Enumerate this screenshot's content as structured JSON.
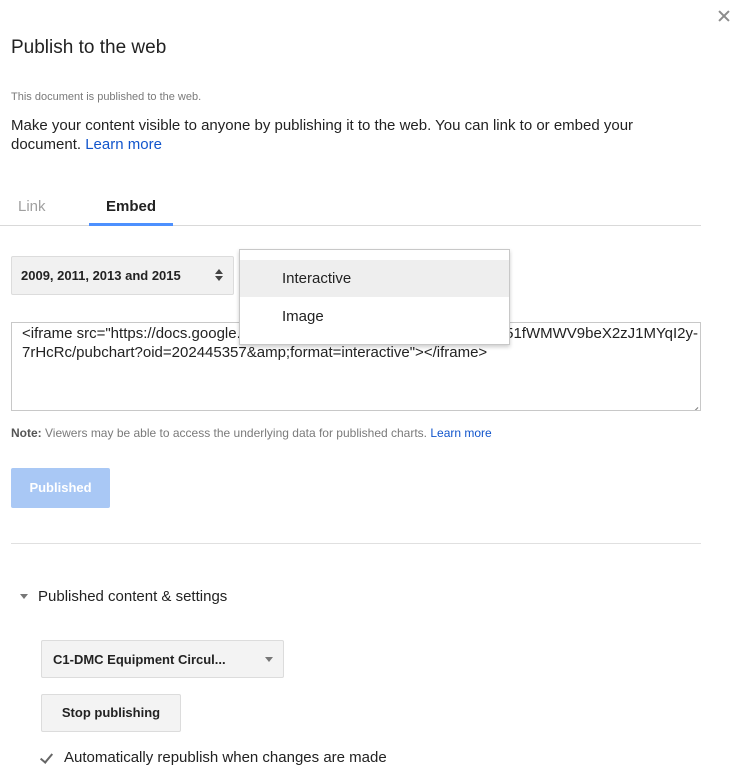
{
  "dialog": {
    "title": "Publish to the web",
    "status": "This document is published to the web.",
    "description": "Make your content visible to anyone by publishing it to the web. You can link to or embed your document.",
    "learn_more": "Learn more"
  },
  "tabs": [
    {
      "label": "Link",
      "active": false
    },
    {
      "label": "Embed",
      "active": true
    }
  ],
  "chart_select": {
    "value": "2009, 2011, 2013 and 2015"
  },
  "format_dropdown": {
    "options": [
      "Interactive",
      "Image"
    ],
    "selected": "Interactive"
  },
  "embed_code": "<iframe src=\"https://docs.google.com/spreadsheets/d/1i09hnqoon3A15ul51fWMWV9beX2zJ1MYqI2y-7rHcRc/pubchart?oid=202445357&amp;format=interactive\"></iframe>",
  "note": {
    "label": "Note:",
    "text": "Viewers may be able to access the underlying data for published charts.",
    "learn_more": "Learn more"
  },
  "published_button": "Published",
  "settings": {
    "toggle_label": "Published content & settings",
    "sheet_select": "C1-DMC Equipment Circul...",
    "stop_button": "Stop publishing",
    "auto_republish_label": "Automatically republish when changes are made",
    "auto_republish_checked": true
  },
  "colors": {
    "accent": "#4d90fe",
    "link": "#1155cc",
    "published_button_bg": "#a9c8f5"
  }
}
